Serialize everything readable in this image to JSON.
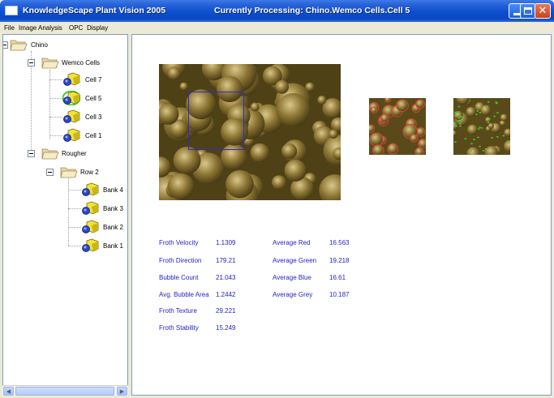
{
  "window": {
    "app_title": "KnowledgeScape Plant Vision 2005",
    "processing_title": "Currently Processing:  Chino.Wemco Cells.Cell 5"
  },
  "menu": [
    "File",
    "Image Analysis",
    "OPC",
    "Display"
  ],
  "tree": {
    "root": "Chino",
    "groups": [
      {
        "label": "Wemco Cells",
        "items": [
          "Cell 7",
          "Cell 5",
          "Cell 3",
          "Cell 1"
        ],
        "selected": "Cell 5"
      },
      {
        "label": "Rougher",
        "subgroups": [
          {
            "label": "Row 2",
            "items": [
              "Bank 4",
              "Bank 3",
              "Bank 2",
              "Bank 1"
            ]
          }
        ]
      }
    ]
  },
  "metrics_left": [
    {
      "label": "Froth Velocity",
      "value": "1.1309"
    },
    {
      "label": "Froth Direction",
      "value": "179.21"
    },
    {
      "label": "Bubble Count",
      "value": "21.043"
    },
    {
      "label": "Avg. Bubble Area",
      "value": "1.2442"
    },
    {
      "label": "Froth Texture",
      "value": "29.221"
    },
    {
      "label": "Froth Stability",
      "value": "15.249"
    }
  ],
  "metrics_right": [
    {
      "label": "Average Red",
      "value": "16.563"
    },
    {
      "label": "Average Green",
      "value": "19.218"
    },
    {
      "label": "Average Blue",
      "value": "16.61"
    },
    {
      "label": "Average Grey",
      "value": "10.187"
    }
  ],
  "icons": {
    "app": "window-icon",
    "minimize": "minimize-icon",
    "maximize": "maximize-icon",
    "close": "close-icon",
    "folder": "folder-icon",
    "cell": "camera-cell-icon"
  },
  "colors": {
    "titlebar": "#0b4fd0",
    "metric_text": "#2323c8",
    "roi_box": "#2b2bd4",
    "selection_ring": "#3ad12a"
  }
}
